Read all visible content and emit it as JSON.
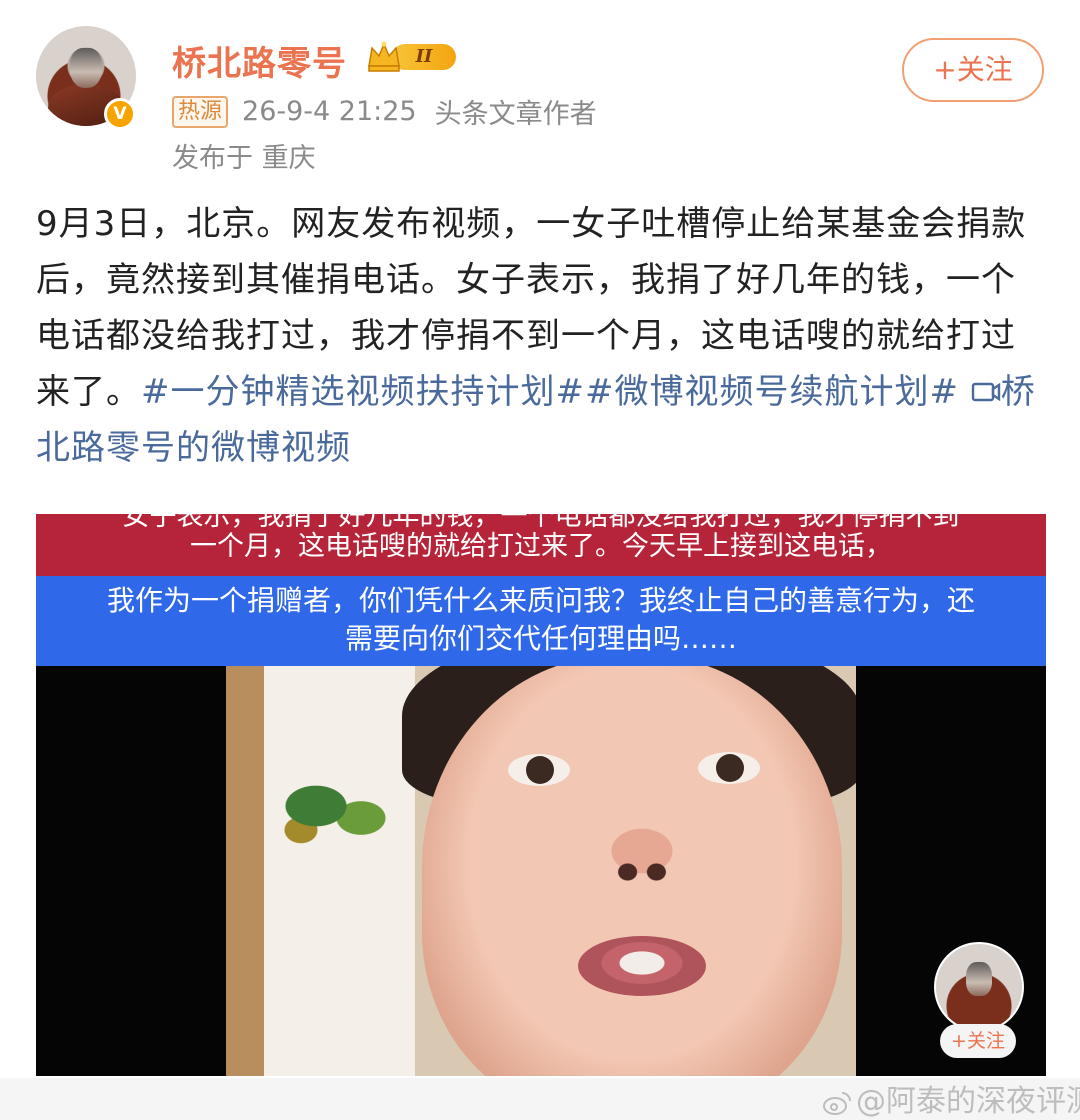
{
  "post": {
    "username": "桥北路零号",
    "level_badge": "II",
    "hot_tag": "热源",
    "time": "26-9-4 21:25",
    "role": "头条文章作者",
    "location": "发布于 重庆",
    "follow_label": "+关注",
    "text_plain": "9月3日，北京。网友发布视频，一女子吐槽停止给某基金会捐款后，竟然接到其催捐电话。女子表示，我捐了好几年的钱，一个电话都没给我打过，我才停捐不到一个月，这电话嗖的就给打过来了。",
    "tag1": "#一分钟精选视频扶持计划#",
    "tag2": "#微博视频号续航计划#",
    "video_link": "桥北路零号的微博视频"
  },
  "video": {
    "caption_red_line1": "女子表示，我捐了好几年的钱，一个电话都没给我打过，我才停捐不到",
    "caption_red_line2": "一个月，这电话嗖的就给打过来了。今天早上接到这电话，",
    "caption_blue_line1": "我作为一个捐赠者，你们凭什么来质问我？我终止自己的善意行为，还",
    "caption_blue_line2": "需要向你们交代任何理由吗……",
    "mini_follow_label": "+关注"
  },
  "watermark": "@阿泰的深夜评测",
  "colors": {
    "username": "#eb7350",
    "tag": "#4a6a9c",
    "caption_red": "#b6243a",
    "caption_blue": "#2f68e8"
  }
}
